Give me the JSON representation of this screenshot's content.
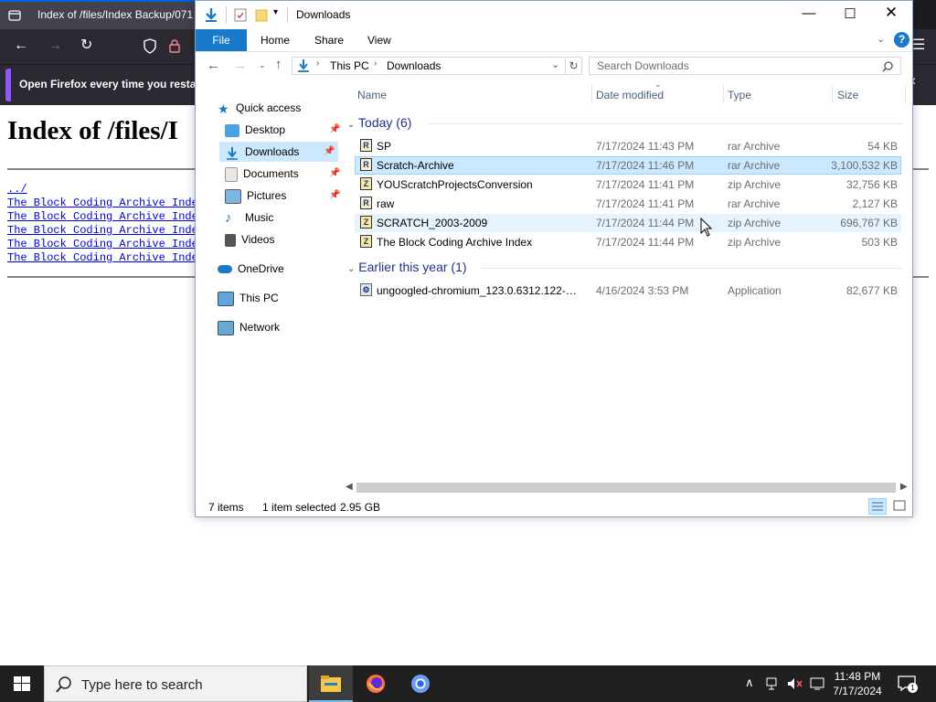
{
  "firefox": {
    "tab_title": "Index of /files/Index Backup/071",
    "notification": "Open Firefox every time you resta",
    "page_title": "Index of /files/I",
    "parent_link": "../",
    "links": [
      "The Block Coding Archive Inde",
      "The Block Coding Archive Inde",
      "The Block Coding Archive Inde",
      "The Block Coding Archive Inde",
      "The Block Coding Archive Inde"
    ]
  },
  "explorer": {
    "title": "Downloads",
    "ribbon": {
      "file": "File",
      "home": "Home",
      "share": "Share",
      "view": "View",
      "help": "?"
    },
    "breadcrumb": {
      "root": "This PC",
      "current": "Downloads"
    },
    "search_placeholder": "Search Downloads",
    "nav": {
      "quick_access": "Quick access",
      "desktop": "Desktop",
      "downloads": "Downloads",
      "documents": "Documents",
      "pictures": "Pictures",
      "music": "Music",
      "videos": "Videos",
      "onedrive": "OneDrive",
      "this_pc": "This PC",
      "network": "Network"
    },
    "columns": {
      "name": "Name",
      "date": "Date modified",
      "type": "Type",
      "size": "Size"
    },
    "groups": {
      "today": "Today (6)",
      "earlier": "Earlier this year (1)"
    },
    "files_today": [
      {
        "name": "SP",
        "date": "7/17/2024 11:43 PM",
        "type": "rar Archive",
        "size": "54 KB",
        "icon": "rar-icon"
      },
      {
        "name": "Scratch-Archive",
        "date": "7/17/2024 11:46 PM",
        "type": "rar Archive",
        "size": "3,100,532 KB",
        "icon": "rar-icon"
      },
      {
        "name": "YOUScratchProjectsConversion",
        "date": "7/17/2024 11:41 PM",
        "type": "zip Archive",
        "size": "32,756 KB",
        "icon": "zip-icon"
      },
      {
        "name": "raw",
        "date": "7/17/2024 11:41 PM",
        "type": "rar Archive",
        "size": "2,127 KB",
        "icon": "rar-icon"
      },
      {
        "name": "SCRATCH_2003-2009",
        "date": "7/17/2024 11:44 PM",
        "type": "zip Archive",
        "size": "696,767 KB",
        "icon": "zip-icon"
      },
      {
        "name": "The Block Coding Archive Index",
        "date": "7/17/2024 11:44 PM",
        "type": "zip Archive",
        "size": "503 KB",
        "icon": "zip-icon"
      }
    ],
    "files_earlier": [
      {
        "name": "ungoogled-chromium_123.0.6312.122-1....",
        "date": "4/16/2024 3:53 PM",
        "type": "Application",
        "size": "82,677 KB",
        "icon": "app-icon"
      }
    ],
    "status": {
      "items": "7 items",
      "selected": "1 item selected",
      "size": "2.95 GB"
    }
  },
  "taskbar": {
    "search_placeholder": "Type here to search",
    "time": "11:48 PM",
    "date": "7/17/2024",
    "notification_count": "1"
  },
  "colors": {
    "explorer_accent": "#1979ca",
    "selection": "#cce8ff",
    "group_header": "#1e3287",
    "firefox_chrome": "#2b2a33",
    "taskbar": "#202020"
  }
}
